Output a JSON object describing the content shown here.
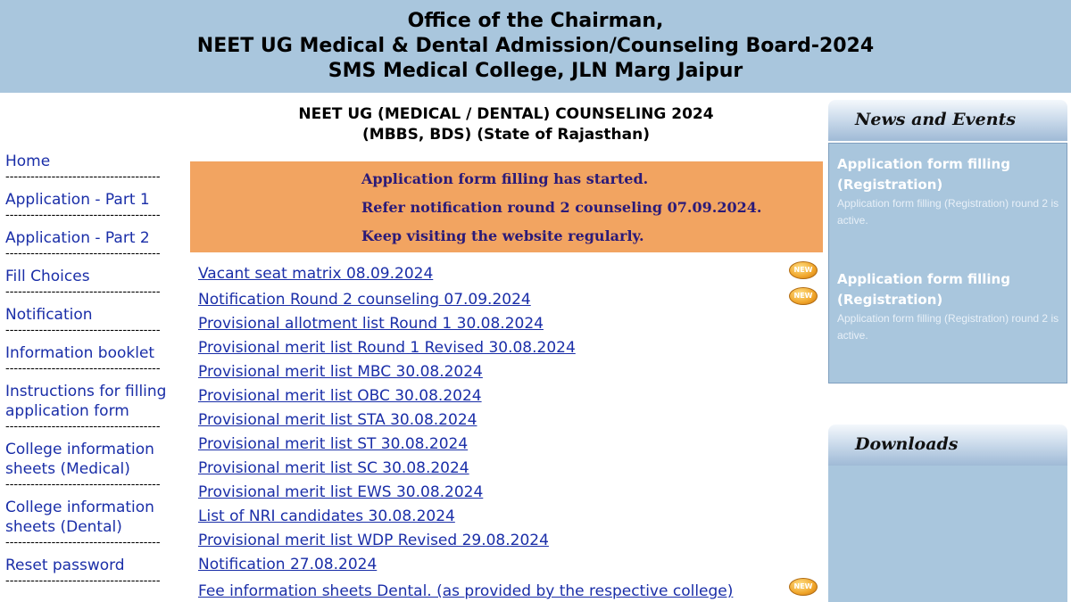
{
  "header": {
    "line1": "Office of the Chairman,",
    "line2": "NEET UG Medical & Dental Admission/Counseling Board-2024",
    "line3": "SMS Medical College, JLN Marg Jaipur"
  },
  "sidebar": {
    "separator": "-------------------------------------",
    "items": [
      {
        "label": "Home"
      },
      {
        "label": "Application - Part 1"
      },
      {
        "label": "Application - Part 2"
      },
      {
        "label": "Fill Choices"
      },
      {
        "label": "Notification"
      },
      {
        "label": "Information booklet"
      },
      {
        "label": "Instructions for filling application form"
      },
      {
        "label": "College information sheets (Medical)"
      },
      {
        "label": "College information sheets (Dental)"
      },
      {
        "label": "Reset password"
      }
    ]
  },
  "main": {
    "title_line1": "NEET UG (MEDICAL / DENTAL) COUNSELING 2024",
    "title_line2": "(MBBS, BDS) (State of Rajasthan)",
    "notice": {
      "line1": "Application form filling has started.",
      "line2": "Refer notification round 2 counseling 07.09.2024.",
      "line3": "Keep visiting the website regularly."
    },
    "new_badge": "NEW",
    "links": [
      {
        "text": "Vacant seat matrix 08.09.2024",
        "is_new": true
      },
      {
        "text": "Notification Round 2 counseling 07.09.2024",
        "is_new": true
      },
      {
        "text": "Provisional allotment list Round 1 30.08.2024",
        "is_new": false
      },
      {
        "text": "Provisional merit list Round 1 Revised 30.08.2024",
        "is_new": false
      },
      {
        "text": "Provisional merit list MBC 30.08.2024",
        "is_new": false
      },
      {
        "text": "Provisional merit list OBC 30.08.2024",
        "is_new": false
      },
      {
        "text": "Provisional merit list STA 30.08.2024",
        "is_new": false
      },
      {
        "text": "Provisional merit list ST 30.08.2024",
        "is_new": false
      },
      {
        "text": "Provisional merit list SC 30.08.2024",
        "is_new": false
      },
      {
        "text": "Provisional merit list EWS 30.08.2024",
        "is_new": false
      },
      {
        "text": "List of NRI candidates 30.08.2024",
        "is_new": false
      },
      {
        "text": "Provisional merit list WDP Revised 29.08.2024",
        "is_new": false
      },
      {
        "text": "Notification 27.08.2024",
        "is_new": false
      },
      {
        "text": "Fee information sheets Dental. (as provided by the respective college)",
        "is_new": true
      }
    ]
  },
  "news": {
    "heading": "News and Events",
    "items": [
      {
        "title": "Application form filling (Registration)",
        "desc": "Application form filling (Registration) round 2 is active."
      },
      {
        "title": "Application form filling (Registration)",
        "desc": "Application form filling (Registration) round 2 is active."
      }
    ]
  },
  "downloads": {
    "heading": "Downloads"
  },
  "colors": {
    "header_bg": "#a9c6dd",
    "notice_bg": "#f2a461",
    "link": "#1a2ea8",
    "notice_text": "#2b1a78"
  }
}
